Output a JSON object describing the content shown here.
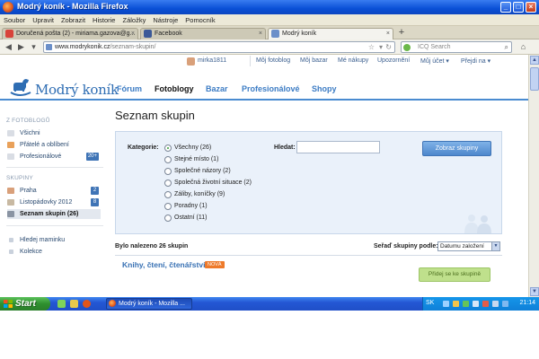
{
  "window": {
    "title": "Modrý koník - Mozilla Firefox"
  },
  "menu": [
    "Soubor",
    "Upravit",
    "Zobrazit",
    "Historie",
    "Záložky",
    "Nástroje",
    "Pomocník"
  ],
  "tabs": [
    {
      "label": "Doručená pošta (2) - miriama.gazova@g..."
    },
    {
      "label": "Facebook"
    },
    {
      "label": "Modrý koník"
    }
  ],
  "nav": {
    "url_host": "www.modrykonik.cz",
    "url_path": "/seznam-skupin/",
    "search_placeholder": "ICQ Search"
  },
  "userbar": {
    "username": "mirka1811",
    "links": [
      "Môj fotoblog",
      "Môj bazar",
      "Mé nákupy",
      "Upozornění",
      "Můj účet ▾",
      "Přejdi na ▾"
    ]
  },
  "site": {
    "logo": "Modrý koník",
    "nav": [
      "Fórum",
      "Fotoblogy",
      "Bazar",
      "Profesionálové",
      "Shopy"
    ]
  },
  "sidebar": {
    "section1_title": "Z FOTOBLOGŮ",
    "section1": [
      {
        "label": "Všichni",
        "count": ""
      },
      {
        "label": "Přátelé a oblíbení",
        "count": ""
      },
      {
        "label": "Profesionálové",
        "count": "20+"
      }
    ],
    "section2_title": "SKUPINY",
    "section2": [
      {
        "label": "Praha",
        "count": "2"
      },
      {
        "label": "Listopádovky 2012",
        "count": "8"
      },
      {
        "label": "Seznam skupin (26)",
        "count": ""
      }
    ],
    "section3": [
      {
        "label": "Hledej maminku"
      },
      {
        "label": "Kolekce"
      }
    ]
  },
  "main": {
    "title": "Seznam skupin",
    "category_label": "Kategorie:",
    "categories": [
      "Všechny (26)",
      "Stejné místo (1)",
      "Společné názory (2)",
      "Společná životní situace (2)",
      "Záliby, koníčky (9)",
      "Poradny (1)",
      "Ostatní (11)"
    ],
    "selected_category": "Všechny (26)",
    "search_label": "Hledat:",
    "search_value": "",
    "show_button": "Zobraz skupiny",
    "found_text": "Bylo nalezeno 26 skupin",
    "sort_label": "Seřaď skupiny podle:",
    "sort_value": "Datumu založení",
    "first_group": {
      "name": "Knihy, čtení, čtenářství",
      "badge": "NOVÁ",
      "join_button": "Přidej se ke skupině"
    }
  },
  "taskbar": {
    "start": "Start",
    "task": "Modrý koník - Mozilla ...",
    "lang": "SK",
    "time": "21:14"
  },
  "colors": {
    "brand_blue": "#3c7cc4",
    "badge_orange": "#ee7a2a",
    "join_green": "#bfe08c"
  }
}
